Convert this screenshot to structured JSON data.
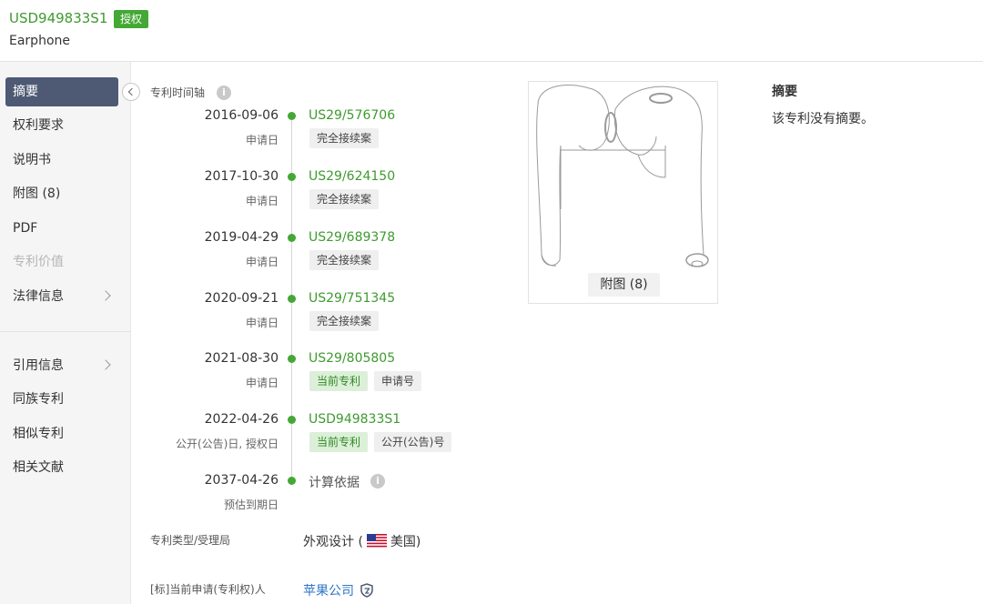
{
  "header": {
    "patent_number": "USD949833S1",
    "status": "授权",
    "title": "Earphone"
  },
  "sidebar": {
    "items": [
      {
        "label": "摘要",
        "active": true
      },
      {
        "label": "权利要求"
      },
      {
        "label": "说明书"
      },
      {
        "label": "附图 (8)"
      },
      {
        "label": "PDF"
      },
      {
        "label": "专利价值",
        "disabled": true
      },
      {
        "label": "法律信息",
        "has_submenu": true
      },
      {
        "label": "引用信息",
        "has_submenu": true
      },
      {
        "label": "同族专利"
      },
      {
        "label": "相似专利"
      },
      {
        "label": "相关文献"
      }
    ]
  },
  "timeline": {
    "title": "专利时间轴",
    "events": [
      {
        "date": "2016-09-06",
        "type": "申请日",
        "number": "US29/576706",
        "badges": [
          "完全接续案"
        ]
      },
      {
        "date": "2017-10-30",
        "type": "申请日",
        "number": "US29/624150",
        "badges": [
          "完全接续案"
        ]
      },
      {
        "date": "2019-04-29",
        "type": "申请日",
        "number": "US29/689378",
        "badges": [
          "完全接续案"
        ]
      },
      {
        "date": "2020-09-21",
        "type": "申请日",
        "number": "US29/751345",
        "badges": [
          "完全接续案"
        ]
      },
      {
        "date": "2021-08-30",
        "type": "申请日",
        "number": "US29/805805",
        "badges": [
          "当前专利",
          "申请号"
        ]
      },
      {
        "date": "2022-04-26",
        "type": "公开(公告)日, 授权日",
        "number": "USD949833S1",
        "badges": [
          "当前专利",
          "公开(公告)号"
        ]
      },
      {
        "date": "2037-04-26",
        "type": "预估到期日",
        "number": "计算依据",
        "badges": []
      }
    ]
  },
  "fields": {
    "type_label": "专利类型/受理局",
    "type_value": "外观设计 (",
    "country": "美国)",
    "assignee_label": "[标]当前申请(专利权)人",
    "assignee_value": "苹果公司"
  },
  "figure": {
    "button_label": "附图 (8)"
  },
  "abstract": {
    "title": "摘要",
    "text": "该专利没有摘要。"
  },
  "colors": {
    "green": "#43a834",
    "active_nav": "#4e5a74",
    "link": "#2e76c9"
  }
}
